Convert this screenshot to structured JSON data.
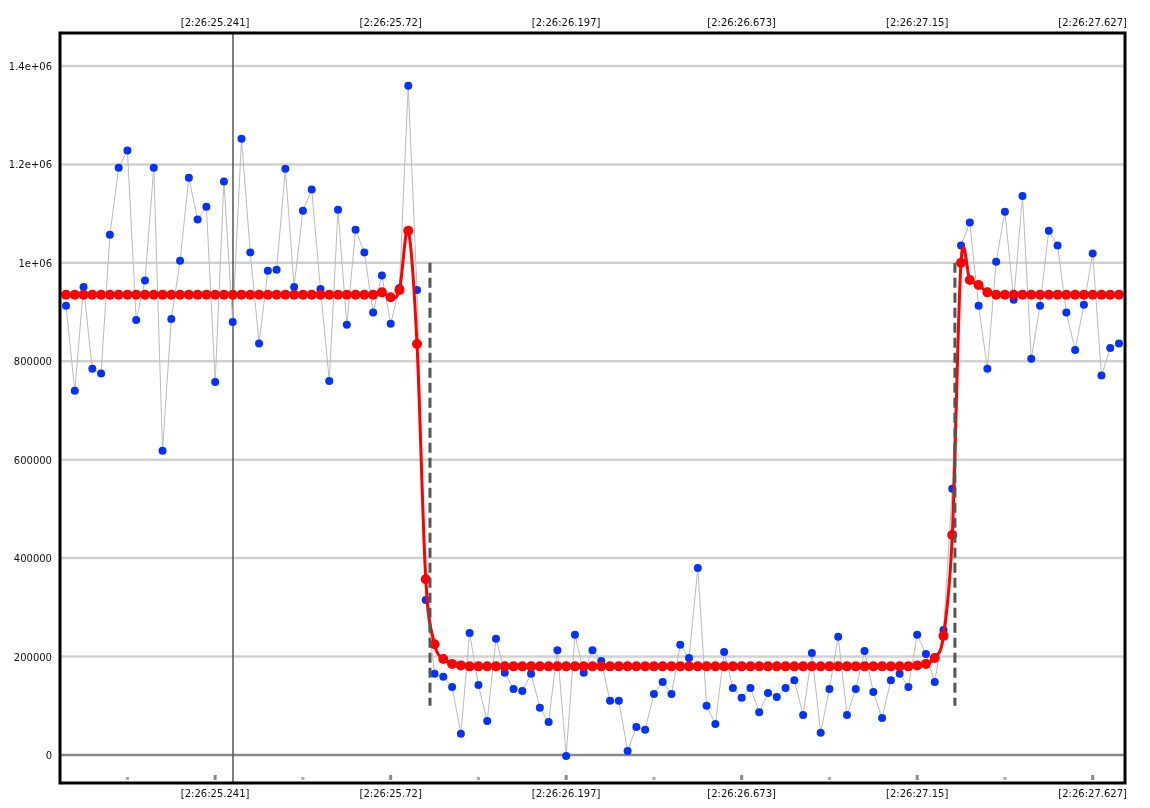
{
  "chart_data": {
    "type": "line",
    "grid": true,
    "ylim": [
      -57000,
      1467000
    ],
    "categories": [
      null,
      null,
      null,
      null,
      null,
      null,
      null,
      null,
      null,
      null,
      null,
      null,
      null,
      null,
      null,
      null,
      null,
      "[2:26:25.241]",
      null,
      null,
      null,
      null,
      null,
      null,
      null,
      null,
      null,
      null,
      null,
      null,
      null,
      null,
      null,
      null,
      null,
      null,
      null,
      "[2:26:25.72]",
      null,
      null,
      null,
      null,
      null,
      null,
      null,
      null,
      null,
      null,
      null,
      null,
      null,
      null,
      null,
      null,
      null,
      null,
      null,
      "[2:26:26.197]",
      null,
      null,
      null,
      null,
      null,
      null,
      null,
      null,
      null,
      null,
      null,
      null,
      null,
      null,
      null,
      null,
      null,
      null,
      null,
      "[2:26:26.673]",
      null,
      null,
      null,
      null,
      null,
      null,
      null,
      null,
      null,
      null,
      null,
      null,
      null,
      null,
      null,
      null,
      null,
      null,
      null,
      "[2:26:27.15]",
      null,
      null,
      null,
      null,
      null,
      null,
      null,
      null,
      null,
      null,
      null,
      null,
      null,
      null,
      null,
      null,
      null,
      null,
      null,
      "[2:26:27.627]",
      null,
      null,
      null
    ],
    "yticks": [
      {
        "value": 0,
        "label": "0"
      },
      {
        "value": 200000,
        "label": "200000"
      },
      {
        "value": 400000,
        "label": "400000"
      },
      {
        "value": 600000,
        "label": "600000"
      },
      {
        "value": 800000,
        "label": "800000"
      },
      {
        "value": 1000000,
        "label": "1e+06"
      },
      {
        "value": 1200000,
        "label": "1.2e+06"
      },
      {
        "value": 1400000,
        "label": "1.4e+06"
      }
    ],
    "series": [
      {
        "color": "#0033ff",
        "marker": "circle",
        "values": [
          913000,
          740000,
          951000,
          785000,
          775000,
          1057000,
          1193000,
          1228000,
          884000,
          964000,
          1193000,
          618000,
          886000,
          1004000,
          1173000,
          1088000,
          1114000,
          758000,
          1165000,
          880000,
          1252000,
          1021000,
          836000,
          984000,
          986000,
          1191000,
          951000,
          1106000,
          1149000,
          947000,
          760000,
          1108000,
          874000,
          1067000,
          1021000,
          899000,
          974000,
          876000,
          949000,
          1360000,
          945000,
          315000,
          165000,
          159000,
          138000,
          43000,
          248000,
          142000,
          69000,
          236000,
          167000,
          134000,
          130000,
          165000,
          96000,
          67000,
          213000,
          -2000,
          244000,
          167000,
          213000,
          191000,
          110000,
          110000,
          8000,
          57000,
          51000,
          124000,
          148000,
          124000,
          224000,
          197000,
          380000,
          100000,
          63000,
          209000,
          136000,
          116000,
          136000,
          87000,
          126000,
          118000,
          136000,
          152000,
          81000,
          207000,
          45000,
          134000,
          240000,
          81000,
          134000,
          211000,
          128000,
          75000,
          152000,
          165000,
          138000,
          244000,
          205000,
          148000,
          254000,
          541000,
          1035000,
          1082000,
          913000,
          785000,
          1002000,
          1104000,
          925000,
          1136000,
          805000,
          913000,
          1065000,
          1035000,
          899000,
          823000,
          915000,
          1019000,
          771000,
          827000,
          836000
        ]
      },
      {
        "color": "#ff0000",
        "marker": "circle",
        "values": [
          935000,
          935000,
          935000,
          935000,
          935000,
          935000,
          935000,
          935000,
          935000,
          935000,
          935000,
          935000,
          935000,
          935000,
          935000,
          935000,
          935000,
          935000,
          935000,
          935000,
          935000,
          935000,
          935000,
          935000,
          935000,
          935000,
          935000,
          935000,
          935000,
          935000,
          935000,
          935000,
          935000,
          935000,
          935000,
          935000,
          940000,
          930000,
          945000,
          1065000,
          835000,
          357000,
          225000,
          195000,
          185000,
          182000,
          180000,
          180000,
          180000,
          180000,
          180000,
          180000,
          180000,
          180000,
          180000,
          180000,
          180000,
          180000,
          180000,
          180000,
          180000,
          180000,
          180000,
          180000,
          180000,
          180000,
          180000,
          180000,
          180000,
          180000,
          180000,
          180000,
          180000,
          180000,
          180000,
          180000,
          180000,
          180000,
          180000,
          180000,
          180000,
          180000,
          180000,
          180000,
          180000,
          180000,
          180000,
          180000,
          180000,
          180000,
          180000,
          180000,
          180000,
          180000,
          180000,
          180000,
          180000,
          182000,
          185000,
          197000,
          242000,
          447000,
          1000000,
          965000,
          955000,
          940000,
          935000,
          935000,
          935000,
          935000,
          935000,
          935000,
          935000,
          935000,
          935000,
          935000,
          935000,
          935000,
          935000,
          935000,
          935000
        ]
      }
    ]
  },
  "top_axis": {
    "labels": [
      "[2:26:25.241]",
      "[2:26:25.72]",
      "[2:26:26.197]",
      "[2:26:26.673]",
      "[2:26:27.15]",
      "[2:26:27.627]"
    ]
  }
}
